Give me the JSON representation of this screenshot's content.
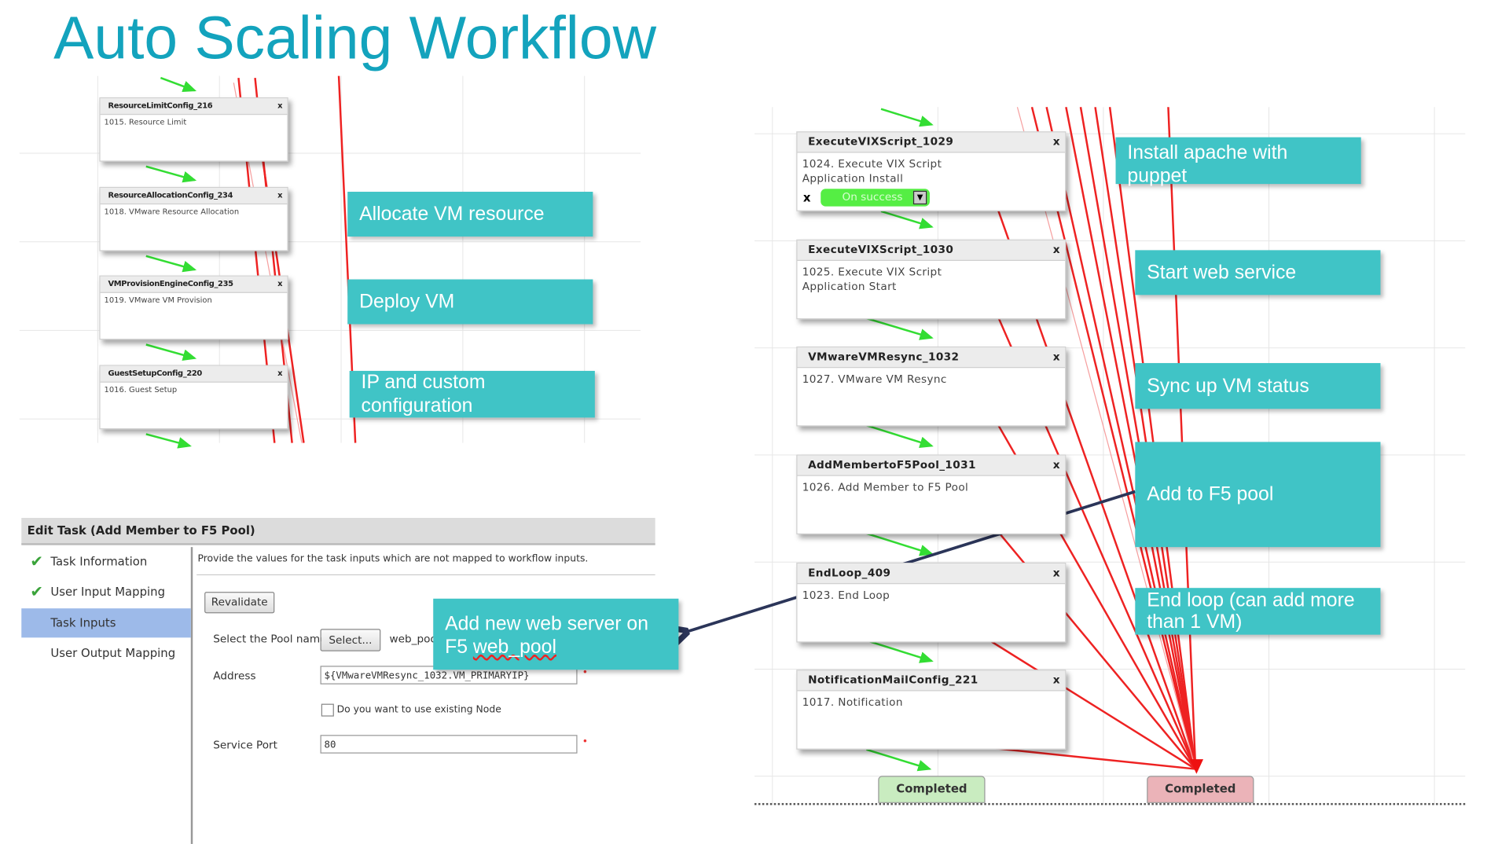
{
  "title": "Auto Scaling Workflow",
  "left_workflow": {
    "nodes": [
      {
        "name": "ResourceLimitConfig_216",
        "desc": "1015. Resource Limit"
      },
      {
        "name": "ResourceAllocationConfig_234",
        "desc": "1018. VMware Resource Allocation"
      },
      {
        "name": "VMProvisionEngineConfig_235",
        "desc": "1019. VMware VM Provision"
      },
      {
        "name": "GuestSetupConfig_220",
        "desc": "1016. Guest Setup"
      }
    ],
    "close_glyph": "x"
  },
  "left_callouts": [
    "Allocate VM resource",
    "Deploy VM",
    "IP and custom configuration"
  ],
  "right_workflow": {
    "nodes": [
      {
        "name": "ExecuteVIXScript_1029",
        "desc": "1024. Execute VIX Script\nApplication Install"
      },
      {
        "name": "ExecuteVIXScript_1030",
        "desc": "1025. Execute VIX Script\nApplication Start"
      },
      {
        "name": "VMwareVMResync_1032",
        "desc": "1027. VMware VM Resync"
      },
      {
        "name": "AddMembertoF5Pool_1031",
        "desc": "1026. Add Member to F5 Pool"
      },
      {
        "name": "EndLoop_409",
        "desc": "1023. End Loop"
      },
      {
        "name": "NotificationMailConfig_221",
        "desc": "1017. Notification"
      }
    ],
    "on_success_label": "On success",
    "completed_success": "Completed",
    "completed_failure": "Completed",
    "colors": {
      "success_edge": "#33dd33",
      "failure_edge": "#ee1111",
      "success_end": "#c9ecc0",
      "failure_end": "#ebb3b8"
    }
  },
  "right_callouts": [
    "Install apache with puppet",
    "Start web service",
    "Sync up VM status",
    "Add to F5 pool",
    "End loop (can add more than 1 VM)"
  ],
  "edit_task": {
    "header": "Edit Task (Add Member to F5 Pool)",
    "steps": [
      {
        "label": "Task Information",
        "done": true
      },
      {
        "label": "User Input Mapping",
        "done": true
      },
      {
        "label": "Task Inputs",
        "selected": true
      },
      {
        "label": "User Output Mapping"
      }
    ],
    "check_glyph": "✔",
    "instructions": "Provide the values for the task inputs which are not mapped to workflow inputs.",
    "revalidate": "Revalidate",
    "pool_label": "Select the Pool name",
    "select_button": "Select...",
    "pool_value": "web_pool",
    "address_label": "Address",
    "address_value": "${VMwareVMResync_1032.VM_PRIMARYIP}",
    "existing_node_label": "Do you want to use existing Node",
    "existing_node_checked": false,
    "port_label": "Service Port",
    "port_value": "80",
    "required_mark": "•"
  },
  "edit_callout": {
    "line1": "Add new web server on",
    "line2_prefix": "F5 ",
    "line2_underlined": "web_pool"
  },
  "accent_color": "#40c4c6"
}
